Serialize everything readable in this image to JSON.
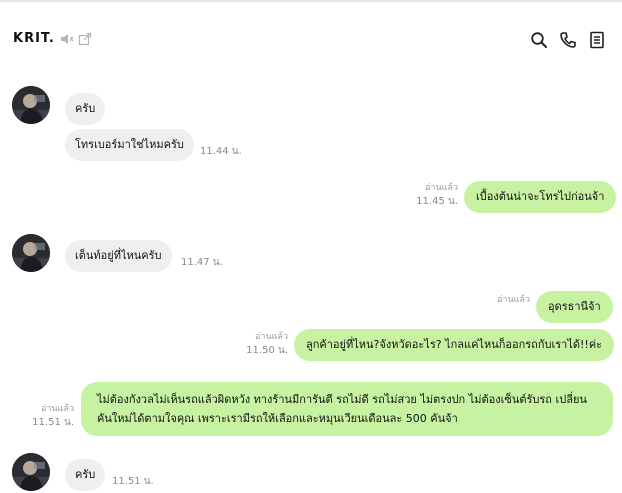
{
  "header": {
    "title": "KRIT.",
    "icons": [
      "speaker-mute-icon",
      "external-link-icon",
      "search-icon",
      "phone-icon",
      "notes-icon"
    ]
  },
  "colors": {
    "incoming_bubble": "#efefef",
    "outgoing_bubble": "#c6f2a2",
    "meta_text": "#8a8a8a"
  },
  "messages": [
    {
      "direction": "in",
      "avatar": true,
      "text": "ครับ"
    },
    {
      "direction": "in",
      "text": "โทรเบอร์มาใช่ไหมครับ",
      "time": "11.44 น."
    },
    {
      "direction": "out",
      "read": "อ่านแล้ว",
      "time": "11.45 น.",
      "text": "เบื้องต้นน่าจะโทรไปก่อนจ้า"
    },
    {
      "direction": "in",
      "avatar": true,
      "text": "เต็นท์อยู่ที่ไหนครับ",
      "time": "11.47 น."
    },
    {
      "direction": "out",
      "read": "อ่านแล้ว",
      "text": "อุดรธานีจ้า"
    },
    {
      "direction": "out",
      "read": "อ่านแล้ว",
      "time": "11.50 น.",
      "text": "ลูกค้าอยู่ที่ไหน?จังหวัดอะไร? ไกลแค่ไหนก็ออกรถกับเราได้!!ค่ะ"
    },
    {
      "direction": "out",
      "read": "อ่านแล้ว",
      "time": "11.51 น.",
      "text": "ไม่ต้องกังวลไม่เห็นรถแล้วผิดหวัง ทางร้านมีการันตี รถไม่ดี รถไม่สวย ไม่ตรงปก ไม่ต้องเซ็นต์รับรถ เปลี่ยนคันใหม่ได้ตามใจคุณ เพราะเรามีรถให้เลือกและหมุนเวียนเดือนละ 500 คันจ้า"
    },
    {
      "direction": "in",
      "avatar": true,
      "text": "ครับ",
      "time": "11.51 น."
    }
  ]
}
